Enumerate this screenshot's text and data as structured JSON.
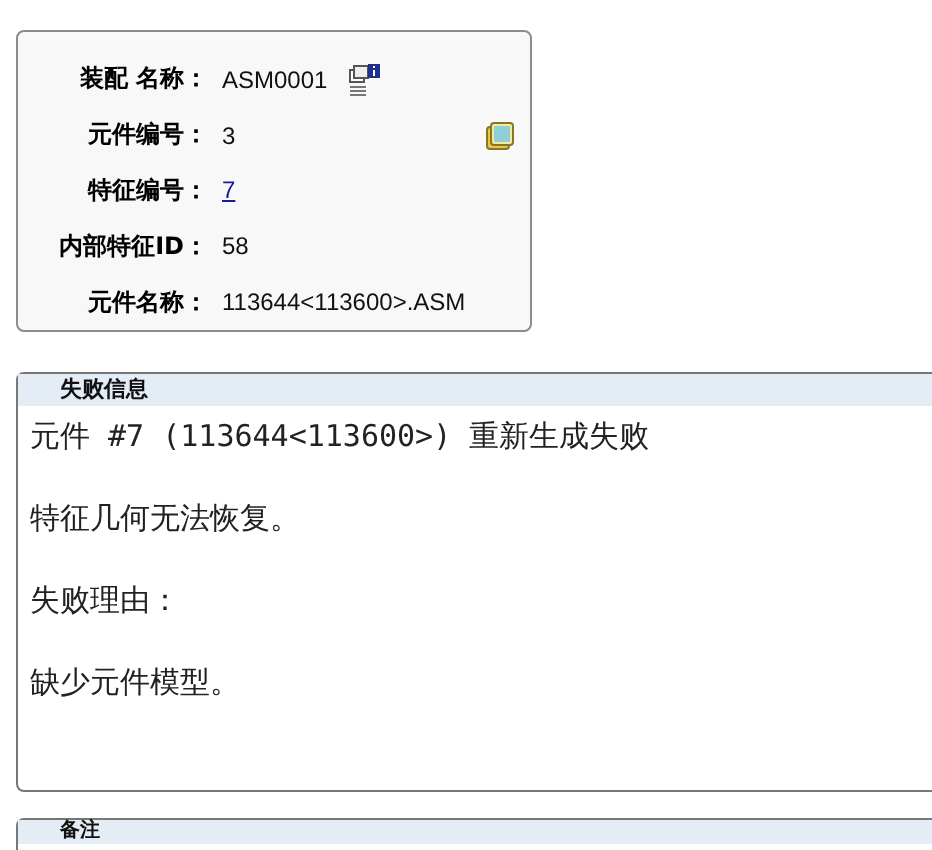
{
  "info_card": {
    "rows": [
      {
        "label": "装配 名称：",
        "value": "ASM0001",
        "kind": "text"
      },
      {
        "label": "元件编号：",
        "value": "3",
        "kind": "text"
      },
      {
        "label": "特征编号：",
        "value": "7",
        "kind": "link"
      },
      {
        "label": "内部特征ID：",
        "value": "58",
        "kind": "text"
      },
      {
        "label": "元件名称：",
        "value": "113644<113600>.ASM",
        "kind": "text"
      }
    ]
  },
  "failure_panel": {
    "title": "失败信息",
    "lines": [
      "元件 #7 (113644<113600>) 重新生成失败",
      "特征几何无法恢复。",
      "失败理由：",
      "缺少元件模型。"
    ]
  },
  "notes_panel": {
    "title": "备注"
  }
}
